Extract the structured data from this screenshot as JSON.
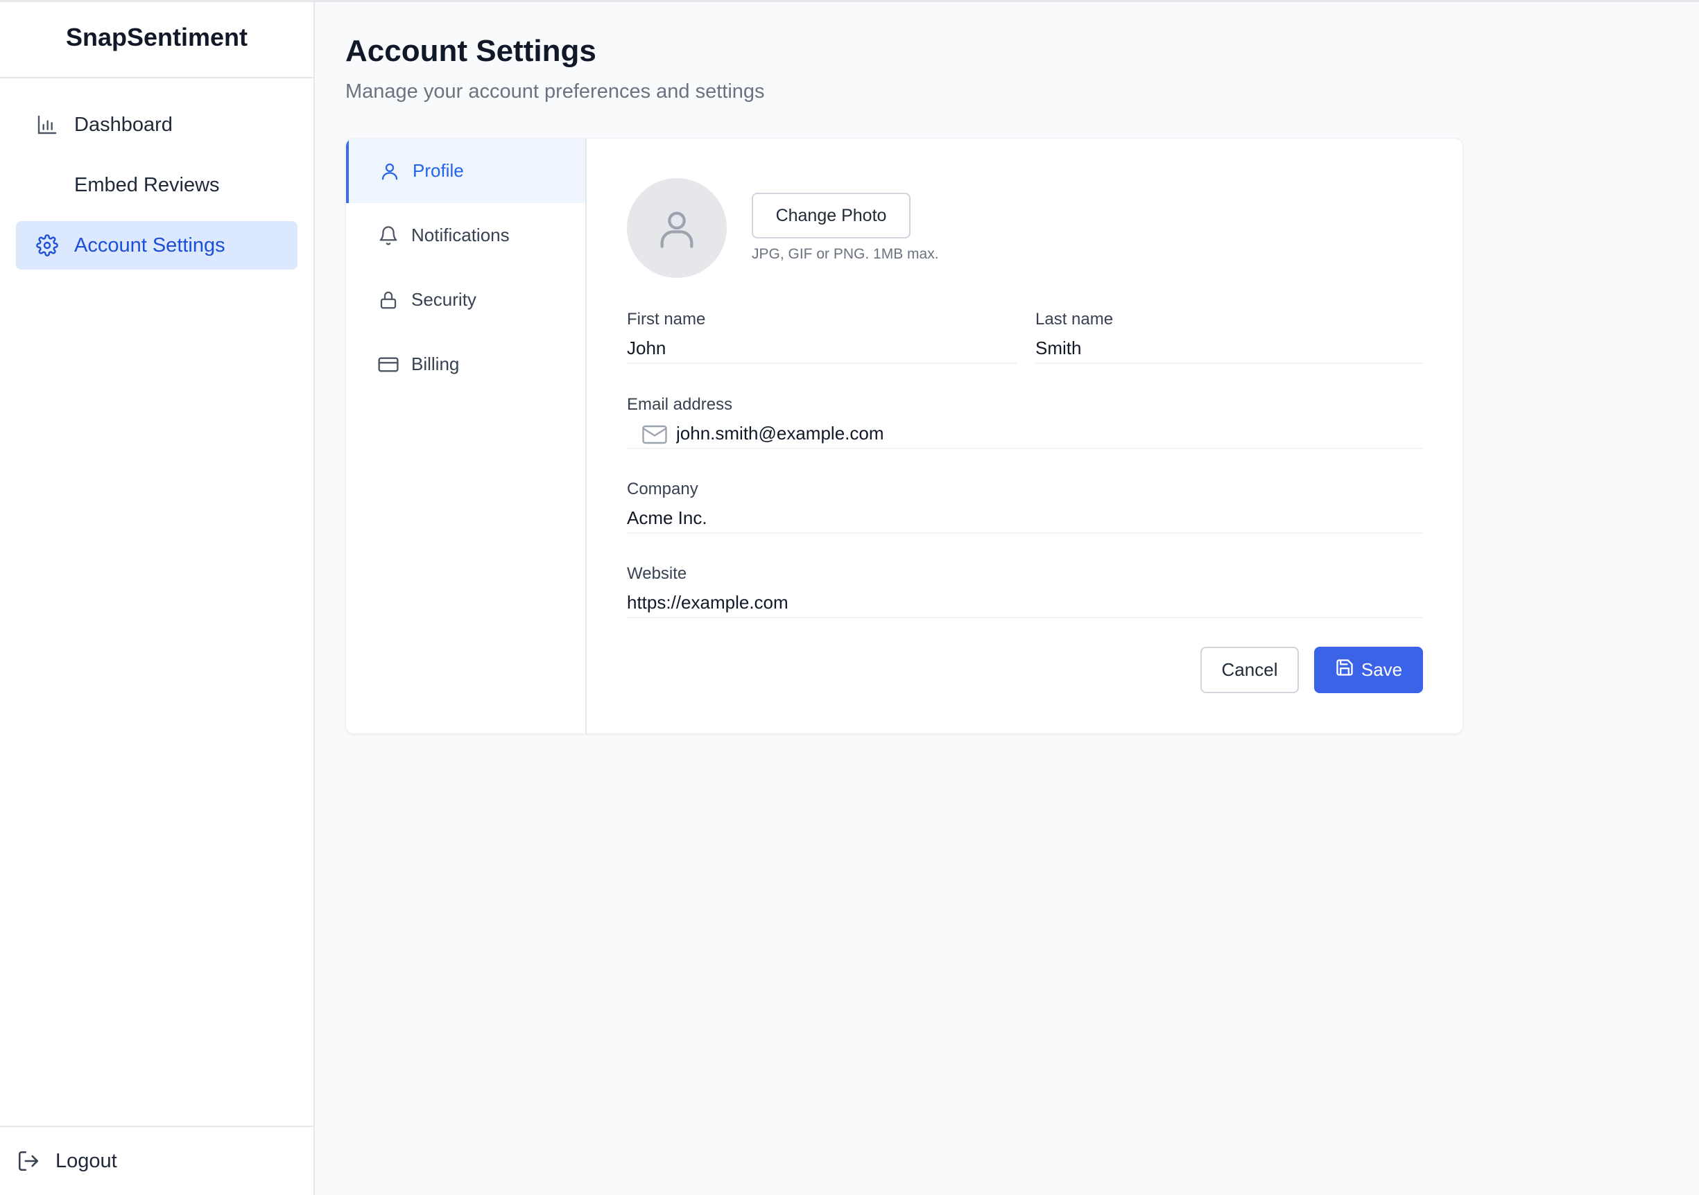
{
  "app": {
    "name": "SnapSentiment"
  },
  "sidebar": {
    "items": [
      {
        "label": "Dashboard",
        "icon": "bar-chart-icon"
      },
      {
        "label": "Embed Reviews",
        "icon": ""
      },
      {
        "label": "Account Settings",
        "icon": "gear-icon",
        "active": true
      }
    ],
    "logout_label": "Logout"
  },
  "page": {
    "title": "Account Settings",
    "subtitle": "Manage your account preferences and settings"
  },
  "tabs": [
    {
      "label": "Profile",
      "icon": "user-icon",
      "active": true
    },
    {
      "label": "Notifications",
      "icon": "bell-icon"
    },
    {
      "label": "Security",
      "icon": "lock-icon"
    },
    {
      "label": "Billing",
      "icon": "credit-card-icon"
    }
  ],
  "profile": {
    "change_photo_label": "Change Photo",
    "photo_hint": "JPG, GIF or PNG. 1MB max.",
    "first_name_label": "First name",
    "first_name_value": "John",
    "last_name_label": "Last name",
    "last_name_value": "Smith",
    "email_label": "Email address",
    "email_value": "john.smith@example.com",
    "company_label": "Company",
    "company_value": "Acme Inc.",
    "website_label": "Website",
    "website_value": "https://example.com",
    "cancel_label": "Cancel",
    "save_label": "Save"
  },
  "colors": {
    "accent": "#3b63e8",
    "active_nav_bg": "#dbe8fe",
    "active_text": "#1d4ed8"
  }
}
